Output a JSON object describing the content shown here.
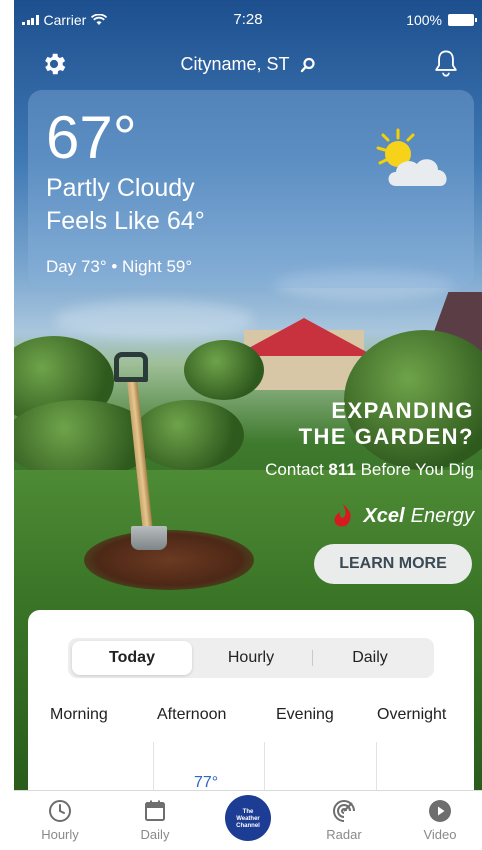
{
  "status_bar": {
    "carrier": "Carrier",
    "time": "7:28",
    "battery": "100%"
  },
  "header": {
    "location": "Cityname, ST"
  },
  "current": {
    "temperature": "67°",
    "condition": "Partly Cloudy",
    "feels_like": "Feels Like 64°",
    "day_night": "Day 73° • Night 59°",
    "icon": "partly-cloudy-icon"
  },
  "ad": {
    "headline_line1": "EXPANDING",
    "headline_line2": "THE GARDEN?",
    "sub_prefix": "Contact ",
    "sub_number": "811",
    "sub_suffix": " Before You Dig",
    "brand_bold": "Xcel",
    "brand_light": "Energy",
    "cta": "LEARN MORE"
  },
  "forecast": {
    "tabs": [
      "Today",
      "Hourly",
      "Daily"
    ],
    "active_tab": "Today",
    "periods": [
      "Morning",
      "Afternoon",
      "Evening",
      "Overnight"
    ],
    "afternoon_temp": "77°"
  },
  "tab_bar": {
    "items": [
      "Hourly",
      "Daily",
      "The Weather Channel",
      "Radar",
      "Video"
    ],
    "logo_line1": "The",
    "logo_line2": "Weather",
    "logo_line3": "Channel"
  },
  "colors": {
    "accent_blue": "#2a67c9",
    "logo_blue": "#1d3d95",
    "ad_cta_bg": "#e9ecea"
  }
}
